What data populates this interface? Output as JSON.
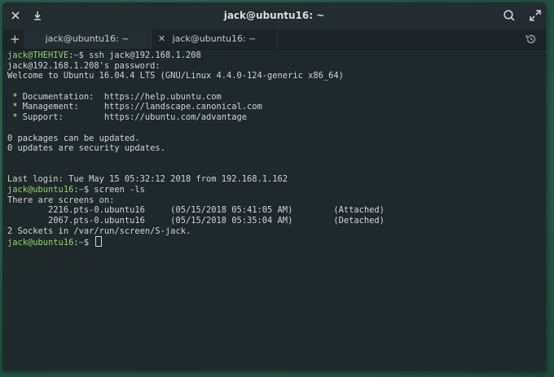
{
  "window": {
    "title": "jack@ubuntu16: ~"
  },
  "titlebar": {
    "left_icons": [
      "close-icon",
      "download-icon"
    ],
    "right_icons": [
      "search-icon",
      "fullscreen-icon"
    ]
  },
  "tabs": [
    {
      "label": "jack@ubuntu16: ~",
      "active": true
    },
    {
      "label": "jack@ubuntu16: ~",
      "active": false,
      "close": "✕"
    }
  ],
  "new_tab_label": "+",
  "terminal": {
    "lines": [
      {
        "user": "jack@THEHIVE",
        "path": "~",
        "cmd": " ssh jack@192.168.1.208"
      },
      {
        "text": "jack@192.168.1.208's password:"
      },
      {
        "text": "Welcome to Ubuntu 16.04.4 LTS (GNU/Linux 4.4.0-124-generic x86_64)"
      },
      {
        "text": ""
      },
      {
        "text": " * Documentation:  https://help.ubuntu.com"
      },
      {
        "text": " * Management:     https://landscape.canonical.com"
      },
      {
        "text": " * Support:        https://ubuntu.com/advantage"
      },
      {
        "text": ""
      },
      {
        "text": "0 packages can be updated."
      },
      {
        "text": "0 updates are security updates."
      },
      {
        "text": ""
      },
      {
        "text": ""
      },
      {
        "text": "Last login: Tue May 15 05:32:12 2018 from 192.168.1.162"
      },
      {
        "user": "jack@ubuntu16",
        "path": "~",
        "cmd": " screen -ls"
      },
      {
        "text": "There are screens on:"
      },
      {
        "text": "        2216.pts-0.ubuntu16     (05/15/2018 05:41:05 AM)        (Attached)"
      },
      {
        "text": "        2067.pts-0.ubuntu16     (05/15/2018 05:35:04 AM)        (Detached)"
      },
      {
        "text": "2 Sockets in /var/run/screen/S-jack."
      },
      {
        "user": "jack@ubuntu16",
        "path": "~",
        "cmd": " ",
        "cursor": true
      }
    ]
  },
  "colors": {
    "prompt_user": "#8fd46a",
    "prompt_path": "#6fb3e0",
    "terminal_bg": "#1f292c",
    "terminal_fg": "#cfd3d4"
  }
}
